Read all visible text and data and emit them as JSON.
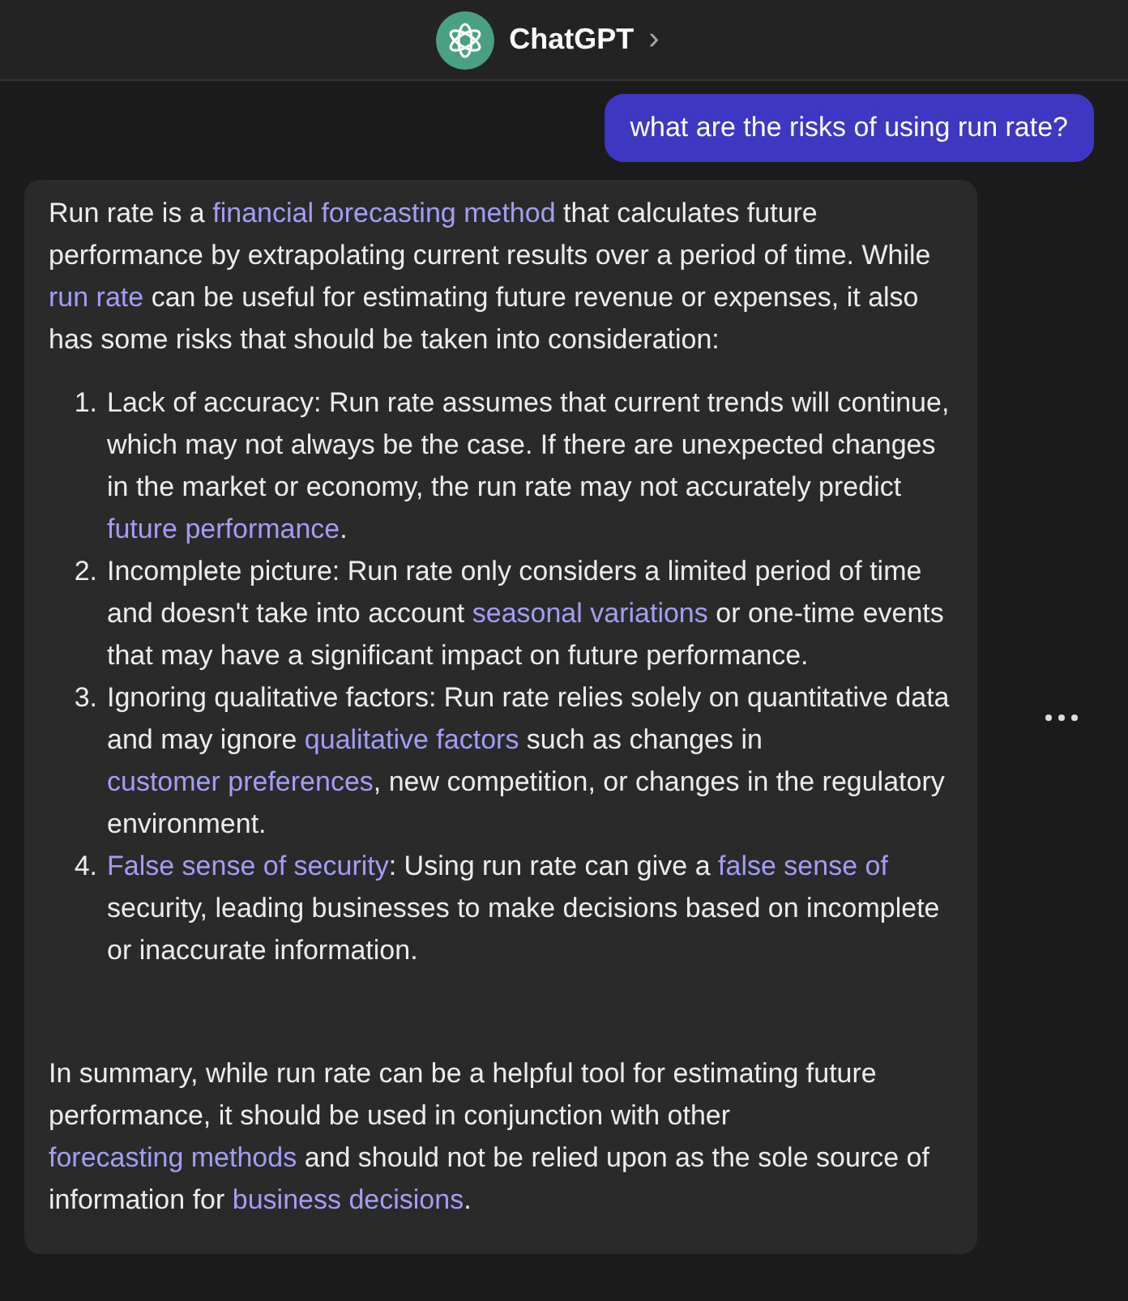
{
  "header": {
    "title": "ChatGPT",
    "chevron": "›"
  },
  "user_message": "what are the risks of using run rate?",
  "assistant_message": {
    "intro": [
      {
        "kind": "text",
        "text": "Run rate is a "
      },
      {
        "kind": "link",
        "text": "financial forecasting method"
      },
      {
        "kind": "text",
        "text": " that calculates future performance by extrapolating current results over a period of time. While "
      },
      {
        "kind": "link",
        "text": "run rate"
      },
      {
        "kind": "text",
        "text": " can be useful for estimating future revenue or expenses, it also has some risks that should be taken into consideration:"
      }
    ],
    "list": [
      {
        "number": "1.",
        "segments": [
          {
            "kind": "text",
            "text": "Lack of accuracy: Run rate assumes that current trends will continue, which may not always be the case. If there are unexpected changes in the market or economy, the run rate may not accurately predict "
          },
          {
            "kind": "link",
            "text": "future performance"
          },
          {
            "kind": "text",
            "text": "."
          }
        ]
      },
      {
        "number": "2.",
        "segments": [
          {
            "kind": "text",
            "text": "Incomplete picture: Run rate only considers a limited period of time and doesn't take into account "
          },
          {
            "kind": "link",
            "text": "seasonal variations"
          },
          {
            "kind": "text",
            "text": " or one-time events that may have a significant impact on future performance."
          }
        ]
      },
      {
        "number": "3.",
        "segments": [
          {
            "kind": "text",
            "text": "Ignoring qualitative factors: Run rate relies solely on quantitative data and may ignore "
          },
          {
            "kind": "link",
            "text": "qualitative factors"
          },
          {
            "kind": "text",
            "text": " such as changes in "
          },
          {
            "kind": "link",
            "text": "customer preferences"
          },
          {
            "kind": "text",
            "text": ", new competition, or changes in the regulatory environment."
          }
        ]
      },
      {
        "number": "4.",
        "segments": [
          {
            "kind": "link",
            "text": "False sense of security"
          },
          {
            "kind": "text",
            "text": ": Using run rate can give a "
          },
          {
            "kind": "link",
            "text": "false sense of"
          },
          {
            "kind": "text",
            "text": " security, leading businesses to make decisions based on incomplete or inaccurate information."
          }
        ]
      }
    ],
    "summary": [
      {
        "kind": "text",
        "text": "In summary, while run rate can be a helpful tool for estimating future performance, it should be used in conjunction with other "
      },
      {
        "kind": "link",
        "text": "forecasting methods"
      },
      {
        "kind": "text",
        "text": " and should not be relied upon as the sole source of information for "
      },
      {
        "kind": "link",
        "text": "business decisions"
      },
      {
        "kind": "text",
        "text": "."
      }
    ]
  }
}
